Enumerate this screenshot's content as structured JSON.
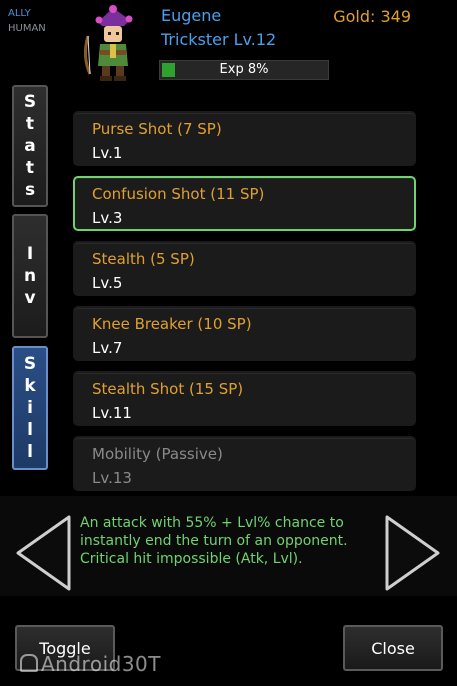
{
  "header": {
    "side": "ALLY",
    "race": "HUMAN",
    "name": "Eugene",
    "class_level": "Trickster Lv.12",
    "gold": "Gold: 349",
    "exp_label": "Exp 8%",
    "exp_fraction": 0.08
  },
  "tabs": {
    "stats": [
      "S",
      "t",
      "a",
      "t",
      "s"
    ],
    "inv": [
      "I",
      "n",
      "v"
    ],
    "skill": [
      "S",
      "k",
      "i",
      "l",
      "l"
    ],
    "active": "skill"
  },
  "skills": [
    {
      "name": "Purse Shot (7 SP)",
      "level": "Lv.1",
      "state": "normal"
    },
    {
      "name": "Confusion Shot (11 SP)",
      "level": "Lv.3",
      "state": "selected"
    },
    {
      "name": "Stealth (5 SP)",
      "level": "Lv.5",
      "state": "normal"
    },
    {
      "name": "Knee Breaker (10 SP)",
      "level": "Lv.7",
      "state": "normal"
    },
    {
      "name": "Stealth Shot (15 SP)",
      "level": "Lv.11",
      "state": "normal"
    },
    {
      "name": "Mobility (Passive)",
      "level": "Lv.13",
      "state": "locked"
    }
  ],
  "description": "An attack with 55% + Lvl% chance to instantly end the turn of an opponent. Critical hit impossible (Atk, Lvl).",
  "buttons": {
    "toggle": "Toggle",
    "close": "Close"
  },
  "watermark": "Android30T",
  "colors": {
    "accent_blue": "#4aa0ee",
    "gold": "#e0a030",
    "selected_green": "#6fd36f",
    "exp_green": "#2ea12e"
  }
}
